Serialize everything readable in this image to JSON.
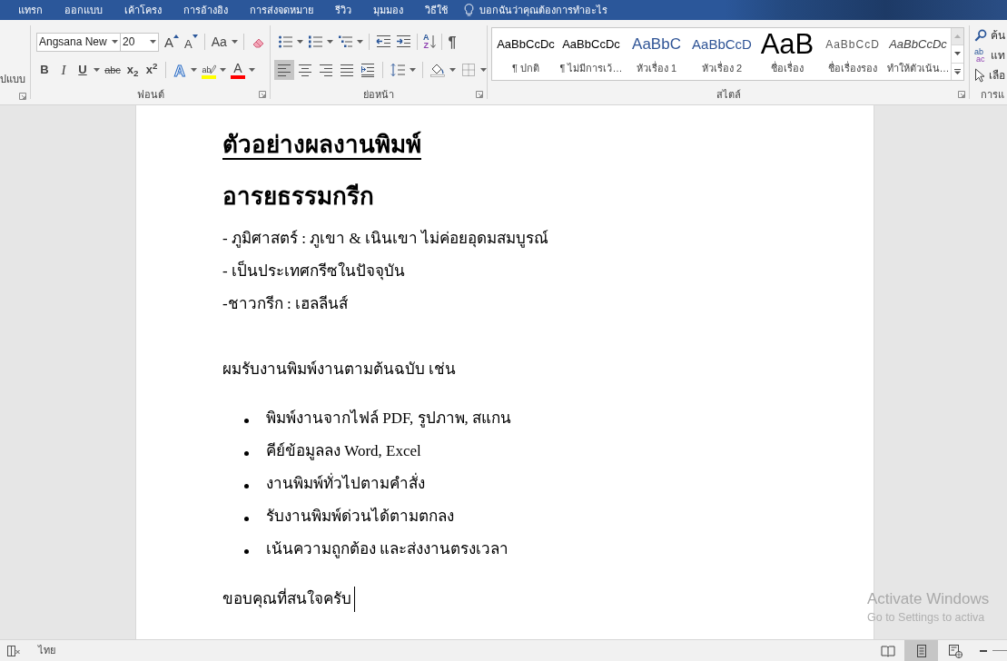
{
  "ribbon_tabs": [
    {
      "label": "แทรก",
      "selected": false
    },
    {
      "label": "ออกแบบ",
      "selected": false
    },
    {
      "label": "เค้าโครง",
      "selected": false
    },
    {
      "label": "การอ้างอิง",
      "selected": false
    },
    {
      "label": "การส่งจดหมาย",
      "selected": false
    },
    {
      "label": "รีวิว",
      "selected": false
    },
    {
      "label": "มุมมอง",
      "selected": false
    },
    {
      "label": "วิธีใช้",
      "selected": false
    }
  ],
  "tell_me": {
    "placeholder": "บอกฉันว่าคุณต้องการทำอะไร"
  },
  "clipboard_group": {
    "format_painter_label": "ปแบบ"
  },
  "font_group": {
    "label": "ฟอนต์",
    "font_name": "Angsana New",
    "font_size": "20",
    "row_1": [
      [
        {
          "kind": "grow_font",
          "glyph": "A",
          "dropdown": false
        },
        {
          "kind": "shrink_font",
          "glyph": "A",
          "dropdown": false
        }
      ],
      [
        {
          "kind": "change_case",
          "glyph": "Aa",
          "dropdown": true
        }
      ],
      [
        {
          "kind": "clear_formatting",
          "dropdown": false
        }
      ]
    ],
    "row_2": [
      [
        {
          "kind": "bold",
          "glyph": "B",
          "dropdown": false
        },
        {
          "kind": "italic",
          "glyph": "I",
          "dropdown": false
        },
        {
          "kind": "underline",
          "glyph": "U",
          "dropdown": true
        },
        {
          "kind": "strikethrough",
          "glyph": "abc",
          "dropdown": false
        },
        {
          "kind": "subscript",
          "glyph": "x$_{2}$",
          "dropdown": false
        },
        {
          "kind": "superscript",
          "glyph": "x$^{2}$",
          "dropdown": false
        }
      ],
      [
        {
          "kind": "text_effects",
          "glyph": "A",
          "dropdown": true
        },
        {
          "kind": "highlight",
          "glyph": "ab",
          "color": "#ffff00",
          "dropdown": true
        },
        {
          "kind": "font_color",
          "glyph": "A",
          "color": "#ff0000",
          "dropdown": true
        }
      ]
    ]
  },
  "paragraph_group": {
    "label": "ย่อหน้า",
    "row_1": [
      [
        {
          "kind": "bullets",
          "dropdown": true
        },
        {
          "kind": "numbering",
          "dropdown": true
        },
        {
          "kind": "multilevel",
          "dropdown": true
        }
      ],
      [
        {
          "kind": "decrease_indent",
          "dropdown": false
        },
        {
          "kind": "increase_indent",
          "dropdown": false
        }
      ],
      [
        {
          "kind": "sort",
          "glyphs": [
            "A",
            "Z"
          ],
          "dropdown": false
        }
      ],
      [
        {
          "kind": "show_marks",
          "glyph": "¶",
          "dropdown": false
        }
      ]
    ],
    "row_2": [
      [
        {
          "kind": "align_left",
          "selected": true,
          "dropdown": false
        },
        {
          "kind": "align_center",
          "selected": false,
          "dropdown": false
        },
        {
          "kind": "align_right",
          "selected": false,
          "dropdown": false
        },
        {
          "kind": "justify",
          "selected": false,
          "dropdown": false
        },
        {
          "kind": "distributed",
          "selected": false,
          "dropdown": false
        }
      ],
      [
        {
          "kind": "line_spacing",
          "dropdown": true
        }
      ],
      [
        {
          "kind": "shading",
          "dropdown": true
        },
        {
          "kind": "borders",
          "dropdown": true
        }
      ]
    ]
  },
  "styles_group": {
    "label": "สไตล์",
    "items": [
      {
        "kind": "normal",
        "preview": "AaBbCcDc",
        "label": "¶ ปกติ",
        "selected": false
      },
      {
        "kind": "no_spacing",
        "preview": "AaBbCcDc",
        "label": "¶ ไม่มีการเว้…",
        "selected": false
      },
      {
        "kind": "heading_1",
        "preview": "AaBbC",
        "label": "หัวเรื่อง 1",
        "selected": false
      },
      {
        "kind": "heading_2",
        "preview": "AaBbCcD",
        "label": "หัวเรื่อง 2",
        "selected": false
      },
      {
        "kind": "title",
        "preview": "AaB",
        "label": "ชื่อเรื่อง",
        "selected": false
      },
      {
        "kind": "subtitle",
        "preview": "AaBbCcD",
        "label": "ชื่อเรื่องรอง",
        "selected": false
      },
      {
        "kind": "emphasis",
        "preview": "AaBbCcDc",
        "label": "ทำให้ตัวเน้น…",
        "selected": false
      }
    ],
    "scroll_buttons": [
      {
        "kind": "up",
        "disabled": true
      },
      {
        "kind": "down",
        "disabled": false
      },
      {
        "kind": "more",
        "disabled": false
      }
    ]
  },
  "editing_group": {
    "label": "การแ",
    "items": [
      {
        "kind": "find",
        "label": "ค้น"
      },
      {
        "kind": "replace",
        "glyphs": [
          "ab",
          "ac"
        ],
        "label": "แท"
      },
      {
        "kind": "select",
        "label": "เลือ"
      }
    ]
  },
  "document": {
    "blocks": [
      {
        "kind": "title",
        "text": "ตัวอย่างผลงานพิมพ์"
      },
      {
        "kind": "heading",
        "text": "อารยธรรมกรีก"
      },
      {
        "kind": "line",
        "text": "- ภูมิศาสตร์ : ภูเขา & เนินเขา ไม่ค่อยอุดมสมบูรณ์"
      },
      {
        "kind": "line",
        "text": "- เป็นประเทศกรีซในปัจจุบัน"
      },
      {
        "kind": "line",
        "text": "-ชาวกรีก : เฮลลีนส์"
      },
      {
        "kind": "lead",
        "text": "ผมรับงานพิมพ์งานตามต้นฉบับ เช่น"
      },
      {
        "kind": "bullet_list",
        "items": [
          "พิมพ์งานจากไฟล์ PDF, รูปภาพ, สแกน",
          "คีย์ข้อมูลลง Word, Excel",
          "งานพิมพ์ทั่วไปตามคำสั่ง",
          "รับงานพิมพ์ด่วนได้ตามตกลง",
          "เน้นความถูกต้อง และส่งงานตรงเวลา"
        ]
      },
      {
        "kind": "closing",
        "text": "ขอบคุณที่สนใจครับ",
        "caret": true
      }
    ]
  },
  "activation_notice": {
    "title": "Activate Windows",
    "body": "Go to Settings to activa"
  },
  "status_bar": {
    "language": "ไทย",
    "views": [
      {
        "kind": "read",
        "selected": false
      },
      {
        "kind": "print",
        "selected": true
      },
      {
        "kind": "web",
        "selected": false
      }
    ]
  }
}
